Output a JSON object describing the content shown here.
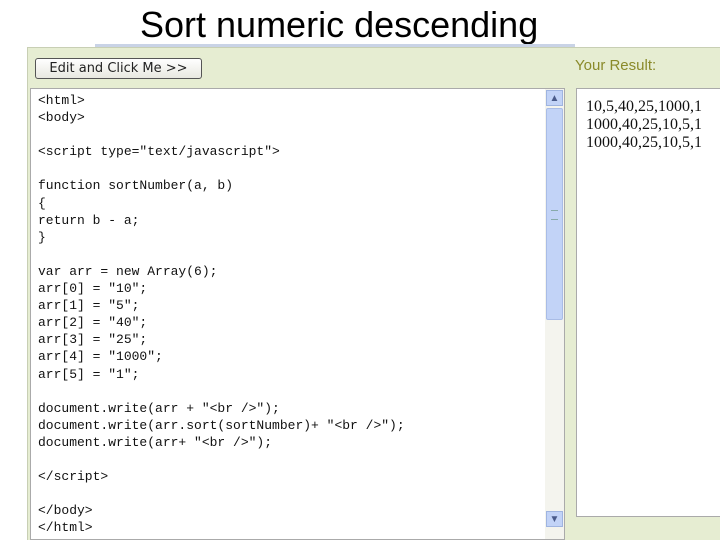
{
  "title": "Sort numeric descending",
  "button_label": "Edit and Click Me >>",
  "result_label": "Your Result:",
  "code_lines": [
    "<html>",
    "<body>",
    "",
    "<script type=\"text/javascript\">",
    "",
    "function sortNumber(a, b)",
    "{",
    "return b - a;",
    "}",
    "",
    "var arr = new Array(6);",
    "arr[0] = \"10\";",
    "arr[1] = \"5\";",
    "arr[2] = \"40\";",
    "arr[3] = \"25\";",
    "arr[4] = \"1000\";",
    "arr[5] = \"1\";",
    "",
    "document.write(arr + \"<br />\");",
    "document.write(arr.sort(sortNumber)+ \"<br />\");",
    "document.write(arr+ \"<br />\");",
    "",
    "</script>",
    "",
    "</body>",
    "</html>"
  ],
  "result_lines": [
    "10,5,40,25,1000,1",
    "1000,40,25,10,5,1",
    "1000,40,25,10,5,1"
  ]
}
